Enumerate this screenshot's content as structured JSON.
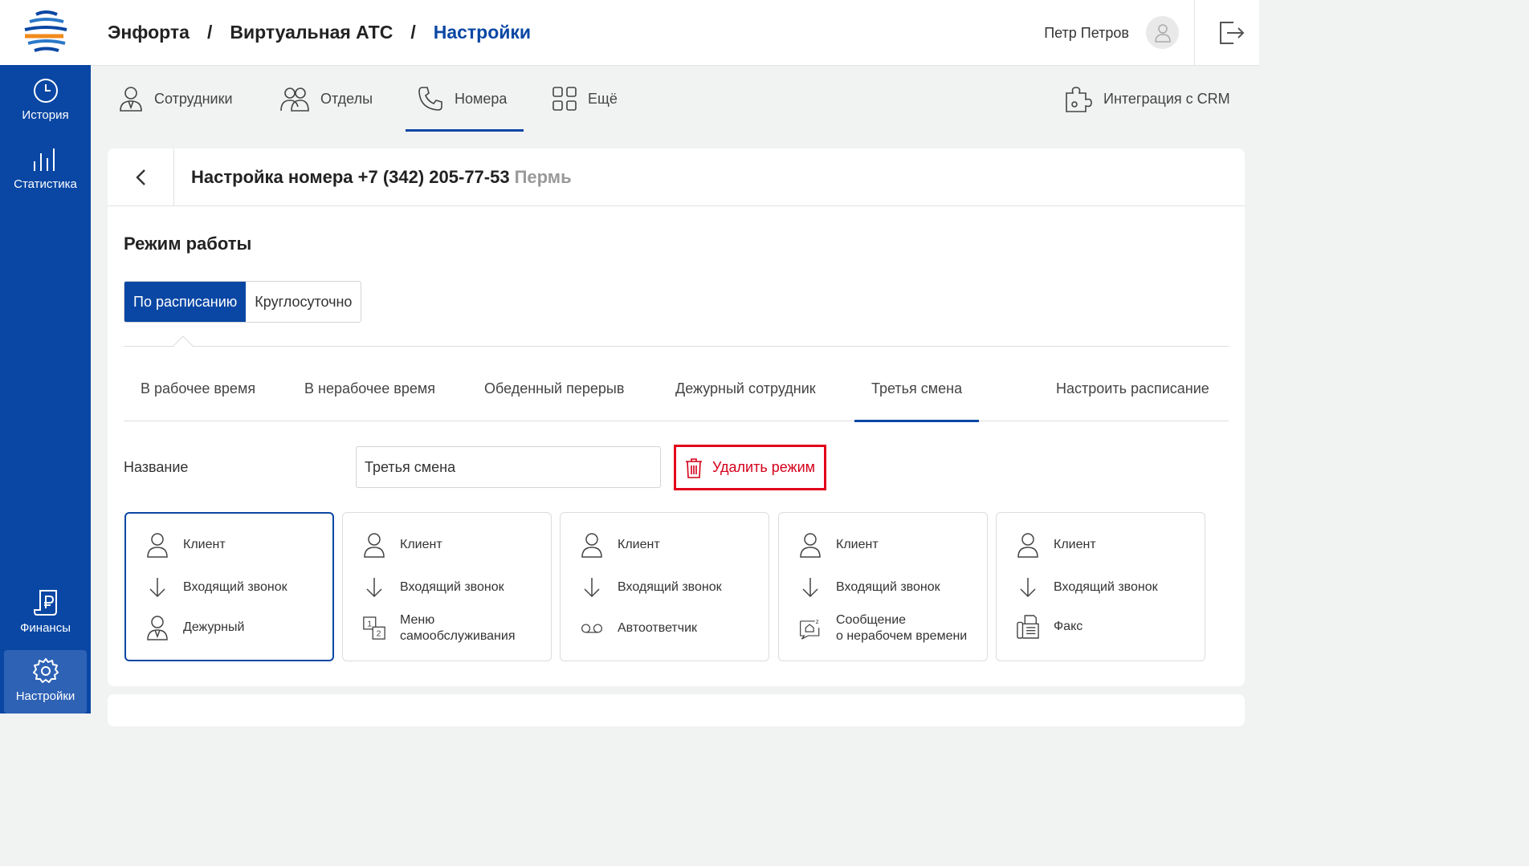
{
  "sidebar": {
    "items": [
      {
        "label": "История",
        "icon": "clock-icon"
      },
      {
        "label": "Статистика",
        "icon": "bar-chart-icon"
      },
      {
        "label": "Финансы",
        "icon": "ruble-document-icon"
      },
      {
        "label": "Настройки",
        "icon": "gear-icon"
      }
    ]
  },
  "header": {
    "breadcrumb": [
      "Энфорта",
      "Виртуальная АТС",
      "Настройки"
    ],
    "separator": "/",
    "user_name": "Петр Петров"
  },
  "topnav": {
    "tabs": [
      {
        "label": "Сотрудники"
      },
      {
        "label": "Отделы"
      },
      {
        "label": "Номера"
      },
      {
        "label": "Ещё"
      }
    ],
    "crm": "Интеграция с CRM"
  },
  "panel": {
    "title": "Настройка номера +7 (342) 205-77-53",
    "city": "Пермь",
    "section_title": "Режим работы",
    "mode_options": [
      "По расписанию",
      "Круглосуточно"
    ],
    "mode_tabs": [
      "В рабочее время",
      "В нерабочее время",
      "Обеденный перерыв",
      "Дежурный сотрудник",
      "Третья смена",
      "Настроить расписание"
    ],
    "name_label": "Название",
    "name_value": "Третья смена",
    "delete_label": "Удалить режим",
    "cards": [
      {
        "client": "Клиент",
        "incoming": "Входящий звонок",
        "target_1": "Дежурный",
        "target_2": "",
        "target_icon": "employee-icon"
      },
      {
        "client": "Клиент",
        "incoming": "Входящий звонок",
        "target_1": "Меню",
        "target_2": "самообслуживания",
        "target_icon": "ivr-menu-icon"
      },
      {
        "client": "Клиент",
        "incoming": "Входящий звонок",
        "target_1": "Автоответчик",
        "target_2": "",
        "target_icon": "voicemail-icon"
      },
      {
        "client": "Клиент",
        "incoming": "Входящий звонок",
        "target_1": "Сообщение",
        "target_2": "о нерабочем времени",
        "target_icon": "sleep-message-icon"
      },
      {
        "client": "Клиент",
        "incoming": "Входящий звонок",
        "target_1": "Факс",
        "target_2": "",
        "target_icon": "fax-icon"
      }
    ]
  },
  "colors": {
    "brand": "#0a47a4",
    "danger": "#e3001b"
  }
}
